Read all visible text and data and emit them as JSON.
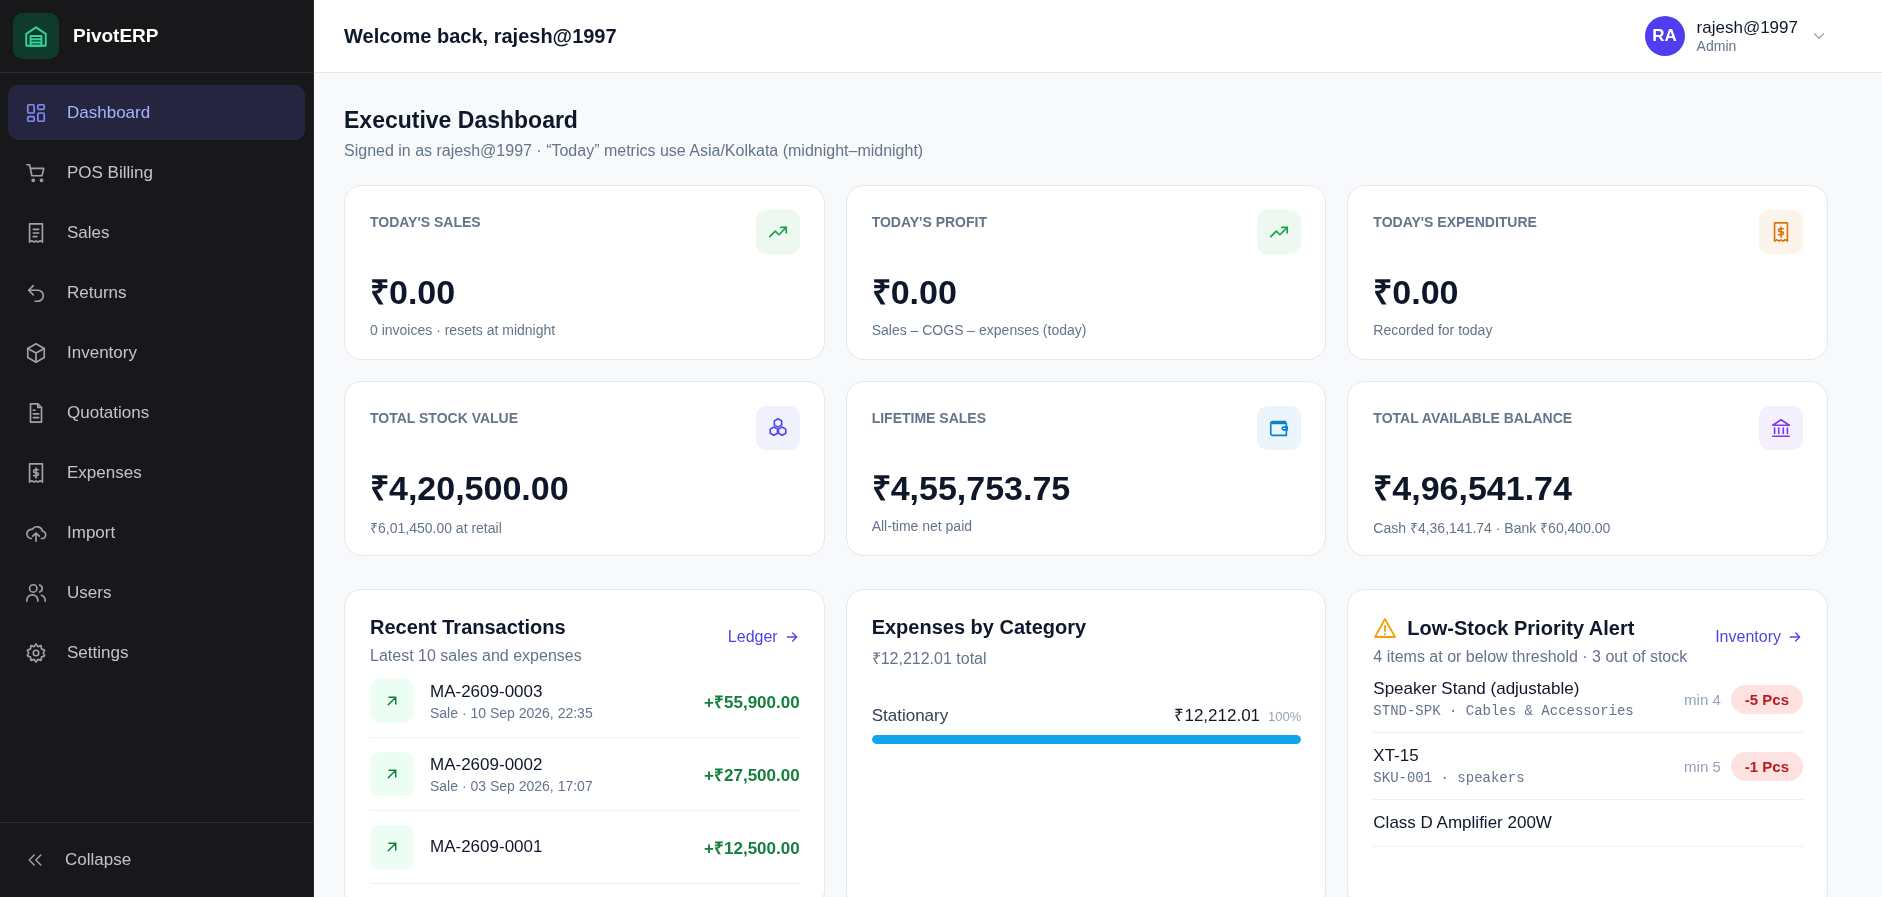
{
  "sidebar": {
    "brand": "PivotERP",
    "items": [
      {
        "label": "Dashboard",
        "selected": true
      },
      {
        "label": "POS Billing",
        "selected": false
      },
      {
        "label": "Sales",
        "selected": false
      },
      {
        "label": "Returns",
        "selected": false
      },
      {
        "label": "Inventory",
        "selected": false
      },
      {
        "label": "Quotations",
        "selected": false
      },
      {
        "label": "Expenses",
        "selected": false
      },
      {
        "label": "Import",
        "selected": false
      },
      {
        "label": "Users",
        "selected": false
      },
      {
        "label": "Settings",
        "selected": false
      }
    ],
    "collapse": "Collapse"
  },
  "header": {
    "welcome": "Welcome back, rajesh@1997",
    "user": {
      "initials": "RA",
      "name": "rajesh@1997",
      "role": "Admin"
    }
  },
  "page": {
    "title": "Executive Dashboard",
    "subtitle": "Signed in as rajesh@1997 · “Today” metrics use Asia/Kolkata (midnight–midnight)"
  },
  "stats": [
    {
      "label": "TODAY'S SALES",
      "value": "₹0.00",
      "note": "0 invoices · resets at midnight"
    },
    {
      "label": "TODAY'S PROFIT",
      "value": "₹0.00",
      "note": "Sales – COGS – expenses (today)"
    },
    {
      "label": "TODAY'S EXPENDITURE",
      "value": "₹0.00",
      "note": "Recorded for today"
    },
    {
      "label": "TOTAL STOCK VALUE",
      "value": "₹4,20,500.00",
      "note": "₹6,01,450.00 at retail"
    },
    {
      "label": "LIFETIME SALES",
      "value": "₹4,55,753.75",
      "note": "All-time net paid"
    },
    {
      "label": "TOTAL AVAILABLE BALANCE",
      "value": "₹4,96,541.74",
      "note": "Cash ₹4,36,141.74 · Bank ₹60,400.00"
    }
  ],
  "recent": {
    "title": "Recent Transactions",
    "subtitle": "Latest 10 sales and expenses",
    "link": "Ledger",
    "rows": [
      {
        "id": "MA-2609-0003",
        "meta": "Sale · 10 Sep 2026, 22:35",
        "amount": "+₹55,900.00"
      },
      {
        "id": "MA-2609-0002",
        "meta": "Sale · 03 Sep 2026, 17:07",
        "amount": "+₹27,500.00"
      },
      {
        "id": "MA-2609-0001",
        "amount": "+₹12,500.00"
      }
    ]
  },
  "expenses": {
    "title": "Expenses by Category",
    "total": "₹12,212.01 total",
    "categories": [
      {
        "name": "Stationary",
        "amount": "₹12,212.01",
        "percent": "100%",
        "level": 1
      }
    ]
  },
  "low_stock": {
    "title": "Low-Stock Priority Alert",
    "subtitle": "4 items at or below threshold · 3 out of stock",
    "link": "Inventory",
    "items": [
      {
        "name": "Speaker Stand (adjustable)",
        "code": "STND-SPK · Cables & Accessories",
        "min": "min 4",
        "badge": "-5 Pcs"
      },
      {
        "name": "XT-15",
        "code": "SKU-001 · speakers",
        "min": "min 5",
        "badge": "-1 Pcs"
      },
      {
        "name": "Class D Amplifier 200W"
      }
    ]
  }
}
